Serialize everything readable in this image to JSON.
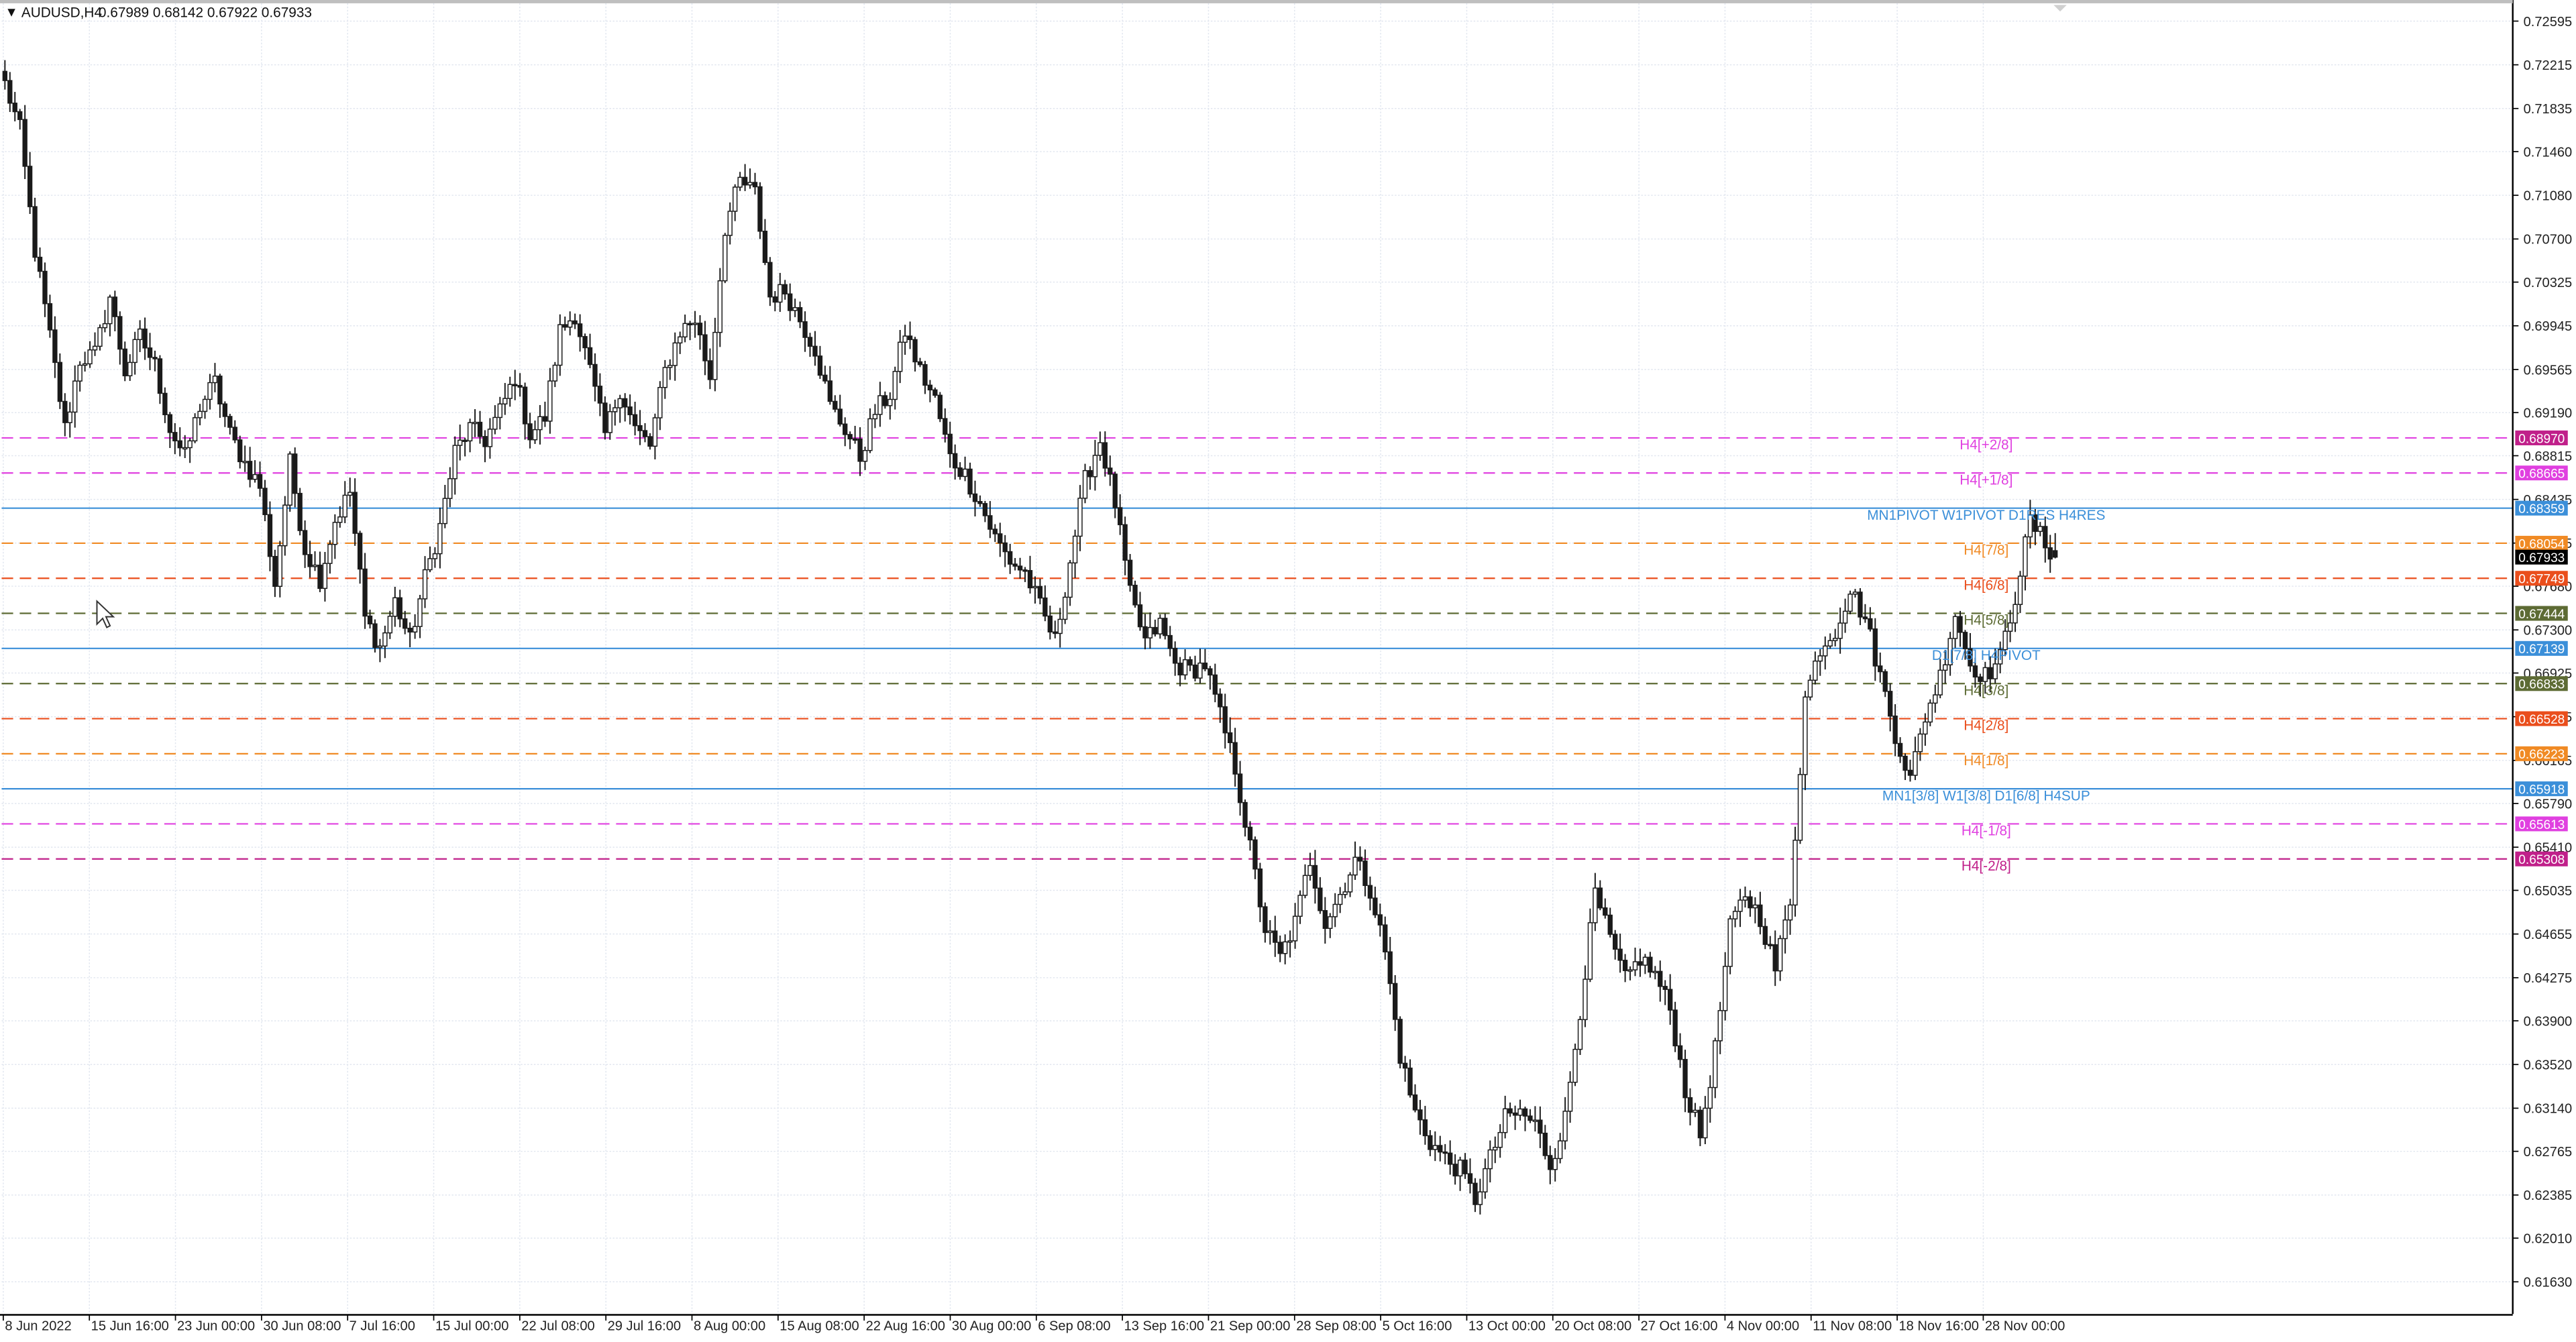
{
  "window": {
    "symbol_header": "AUDUSD,H4",
    "ohlc": "0.67989 0.68142 0.67922 0.67933"
  },
  "colors": {
    "background": "#ffffff",
    "grid": "#e1e6ef",
    "candle": "#1a1a1a",
    "axis_text": "#222222",
    "pivot_blue": "#3b8fd9",
    "magenta": "#e040e0",
    "dark_magenta": "#c0208a",
    "orange": "#f08a24",
    "red_orange": "#ea4e1c",
    "olive": "#5d6b34",
    "gray": "#9a9a9a"
  },
  "price_axis": {
    "ticks": [
      "0.72595",
      "0.72215",
      "0.71835",
      "0.71460",
      "0.71080",
      "0.70700",
      "0.70325",
      "0.69945",
      "0.69565",
      "0.69190",
      "0.68815",
      "0.68435",
      "0.68055",
      "0.67680",
      "0.67300",
      "0.66925",
      "0.66545",
      "0.66165",
      "0.65790",
      "0.65410",
      "0.65035",
      "0.64655",
      "0.64275",
      "0.63900",
      "0.63520",
      "0.63140",
      "0.62765",
      "0.62385",
      "0.62010",
      "0.61630"
    ]
  },
  "time_axis": {
    "labels": [
      "8 Jun 2022",
      "15 Jun 16:00",
      "23 Jun 00:00",
      "30 Jun 08:00",
      "7 Jul 16:00",
      "15 Jul 00:00",
      "22 Jul 08:00",
      "29 Jul 16:00",
      "8 Aug 00:00",
      "15 Aug 08:00",
      "22 Aug 16:00",
      "30 Aug 00:00",
      "6 Sep 08:00",
      "13 Sep 16:00",
      "21 Sep 00:00",
      "28 Sep 08:00",
      "5 Oct 16:00",
      "13 Oct 00:00",
      "20 Oct 08:00",
      "27 Oct 16:00",
      "4 Nov 00:00",
      "11 Nov 08:00",
      "18 Nov 16:00",
      "28 Nov 00:00"
    ]
  },
  "levels": [
    {
      "label": "H4[+2/8]",
      "price": 0.6897,
      "tag": "0.68970",
      "color": "#e040e0",
      "tagcolor": "#c0208a",
      "style": "dash"
    },
    {
      "label": "H4[+1/8]",
      "price": 0.68665,
      "tag": "0.68665",
      "color": "#e040e0",
      "tagcolor": "#e040e0",
      "style": "dash"
    },
    {
      "label": "MN1PIVOT W1PIVOT D1RES H4RES",
      "price": 0.68359,
      "tag": "0.68359",
      "color": "#3b8fd9",
      "tagcolor": "#3b8fd9",
      "style": "solid"
    },
    {
      "label": "H4[7/8]",
      "price": 0.68054,
      "tag": "0.68054",
      "color": "#f08a24",
      "tagcolor": "#f08a24",
      "style": "dash"
    },
    {
      "label": "H4[6/8]",
      "price": 0.67749,
      "tag": "0.67749",
      "color": "#ea4e1c",
      "tagcolor": "#ea4e1c",
      "style": "dash"
    },
    {
      "label": "H4[5/8]",
      "price": 0.67444,
      "tag": "0.67444",
      "color": "#5d6b34",
      "tagcolor": "#5d6b34",
      "style": "dash"
    },
    {
      "label": "D1[7/8] H4PIVOT",
      "price": 0.67139,
      "tag": "0.67139",
      "color": "#3b8fd9",
      "tagcolor": "#3b8fd9",
      "style": "solid"
    },
    {
      "label": "H4[3/8]",
      "price": 0.66833,
      "tag": "0.66833",
      "color": "#5d6b34",
      "tagcolor": "#5d6b34",
      "style": "dash"
    },
    {
      "label": "H4[2/8]",
      "price": 0.66528,
      "tag": "0.66528",
      "color": "#ea4e1c",
      "tagcolor": "#ea4e1c",
      "style": "dash"
    },
    {
      "label": "H4[1/8]",
      "price": 0.66223,
      "tag": "0.66223",
      "color": "#f08a24",
      "tagcolor": "#f08a24",
      "style": "dash"
    },
    {
      "label": "MN1[3/8] W1[3/8] D1[6/8] H4SUP",
      "price": 0.65918,
      "tag": "0.65918",
      "color": "#3b8fd9",
      "tagcolor": "#3b8fd9",
      "style": "solid"
    },
    {
      "label": "H4[-1/8]",
      "price": 0.65613,
      "tag": "0.65613",
      "color": "#e040e0",
      "tagcolor": "#e040e0",
      "style": "dash"
    },
    {
      "label": "H4[-2/8]",
      "price": 0.65308,
      "tag": "0.65308",
      "color": "#c0208a",
      "tagcolor": "#c0208a",
      "style": "dash"
    }
  ],
  "current_price": {
    "price": 0.67933,
    "tag": "0.67933",
    "color": "#000000"
  },
  "chart_data": {
    "type": "candlestick",
    "symbol": "AUDUSD",
    "timeframe": "H4",
    "y_range": [
      0.6135,
      0.7275
    ],
    "x_labels": [
      "8 Jun 2022",
      "15 Jun 16:00",
      "23 Jun 00:00",
      "30 Jun 08:00",
      "7 Jul 16:00",
      "15 Jul 00:00",
      "22 Jul 08:00",
      "29 Jul 16:00",
      "8 Aug 00:00",
      "15 Aug 08:00",
      "22 Aug 16:00",
      "30 Aug 00:00",
      "6 Sep 08:00",
      "13 Sep 16:00",
      "21 Sep 00:00",
      "28 Sep 08:00",
      "5 Oct 16:00",
      "13 Oct 00:00",
      "20 Oct 08:00",
      "27 Oct 16:00",
      "4 Nov 00:00",
      "11 Nov 08:00",
      "18 Nov 16:00",
      "28 Nov 00:00"
    ],
    "close_path": [
      [
        0,
        0.7205
      ],
      [
        3,
        0.7165
      ],
      [
        6,
        0.706
      ],
      [
        9,
        0.6985
      ],
      [
        12,
        0.6905
      ],
      [
        15,
        0.6965
      ],
      [
        18,
        0.697
      ],
      [
        21,
        0.702
      ],
      [
        24,
        0.6955
      ],
      [
        27,
        0.6985
      ],
      [
        30,
        0.696
      ],
      [
        33,
        0.6905
      ],
      [
        36,
        0.688
      ],
      [
        39,
        0.6925
      ],
      [
        42,
        0.6945
      ],
      [
        45,
        0.69
      ],
      [
        48,
        0.6875
      ],
      [
        51,
        0.6855
      ],
      [
        54,
        0.677
      ],
      [
        57,
        0.6875
      ],
      [
        60,
        0.68
      ],
      [
        63,
        0.6775
      ],
      [
        66,
        0.6825
      ],
      [
        69,
        0.685
      ],
      [
        72,
        0.674
      ],
      [
        75,
        0.6715
      ],
      [
        78,
        0.6755
      ],
      [
        81,
        0.672
      ],
      [
        84,
        0.6775
      ],
      [
        87,
        0.682
      ],
      [
        90,
        0.6885
      ],
      [
        93,
        0.6905
      ],
      [
        96,
        0.6895
      ],
      [
        99,
        0.692
      ],
      [
        102,
        0.695
      ],
      [
        105,
        0.69
      ],
      [
        108,
        0.6915
      ],
      [
        111,
        0.699
      ],
      [
        114,
        0.7005
      ],
      [
        117,
        0.6955
      ],
      [
        120,
        0.69
      ],
      [
        123,
        0.694
      ],
      [
        126,
        0.6905
      ],
      [
        129,
        0.689
      ],
      [
        132,
        0.6955
      ],
      [
        135,
        0.699
      ],
      [
        138,
        0.7
      ],
      [
        141,
        0.695
      ],
      [
        144,
        0.708
      ],
      [
        147,
        0.712
      ],
      [
        150,
        0.711
      ],
      [
        153,
        0.702
      ],
      [
        156,
        0.7025
      ],
      [
        159,
        0.7
      ],
      [
        162,
        0.6975
      ],
      [
        165,
        0.6925
      ],
      [
        168,
        0.6905
      ],
      [
        171,
        0.688
      ],
      [
        174,
        0.692
      ],
      [
        177,
        0.6935
      ],
      [
        180,
        0.699
      ],
      [
        183,
        0.6955
      ],
      [
        186,
        0.693
      ],
      [
        189,
        0.688
      ],
      [
        192,
        0.6865
      ],
      [
        195,
        0.684
      ],
      [
        198,
        0.681
      ],
      [
        201,
        0.679
      ],
      [
        204,
        0.678
      ],
      [
        207,
        0.675
      ],
      [
        210,
        0.672
      ],
      [
        213,
        0.679
      ],
      [
        216,
        0.686
      ],
      [
        219,
        0.6895
      ],
      [
        222,
        0.684
      ],
      [
        225,
        0.676
      ],
      [
        228,
        0.672
      ],
      [
        231,
        0.6735
      ],
      [
        234,
        0.67
      ],
      [
        237,
        0.6695
      ],
      [
        240,
        0.67
      ],
      [
        243,
        0.6655
      ],
      [
        246,
        0.661
      ],
      [
        249,
        0.654
      ],
      [
        252,
        0.647
      ],
      [
        255,
        0.6445
      ],
      [
        258,
        0.6475
      ],
      [
        261,
        0.653
      ],
      [
        264,
        0.6475
      ],
      [
        267,
        0.65
      ],
      [
        270,
        0.653
      ],
      [
        273,
        0.6505
      ],
      [
        276,
        0.645
      ],
      [
        279,
        0.636
      ],
      [
        282,
        0.631
      ],
      [
        285,
        0.6285
      ],
      [
        288,
        0.627
      ],
      [
        291,
        0.626
      ],
      [
        294,
        0.6235
      ],
      [
        297,
        0.627
      ],
      [
        300,
        0.6305
      ],
      [
        303,
        0.631
      ],
      [
        306,
        0.63
      ],
      [
        309,
        0.6265
      ],
      [
        312,
        0.6305
      ],
      [
        315,
        0.64
      ],
      [
        318,
        0.65
      ],
      [
        321,
        0.646
      ],
      [
        324,
        0.6425
      ],
      [
        327,
        0.6445
      ],
      [
        330,
        0.643
      ],
      [
        333,
        0.64
      ],
      [
        336,
        0.633
      ],
      [
        339,
        0.629
      ],
      [
        342,
        0.6365
      ],
      [
        345,
        0.647
      ],
      [
        348,
        0.65
      ],
      [
        351,
        0.648
      ],
      [
        354,
        0.6435
      ],
      [
        357,
        0.6495
      ],
      [
        360,
        0.667
      ],
      [
        363,
        0.6715
      ],
      [
        366,
        0.673
      ],
      [
        369,
        0.6765
      ],
      [
        372,
        0.674
      ],
      [
        375,
        0.669
      ],
      [
        378,
        0.664
      ],
      [
        381,
        0.66
      ],
      [
        384,
        0.6655
      ],
      [
        387,
        0.669
      ],
      [
        390,
        0.6745
      ],
      [
        393,
        0.67
      ],
      [
        396,
        0.669
      ],
      [
        399,
        0.6705
      ],
      [
        402,
        0.676
      ],
      [
        405,
        0.6825
      ],
      [
        408,
        0.6805
      ],
      [
        410,
        0.6793
      ]
    ],
    "last": {
      "open": 0.67989,
      "high": 0.68142,
      "low": 0.67922,
      "close": 0.67933
    }
  }
}
